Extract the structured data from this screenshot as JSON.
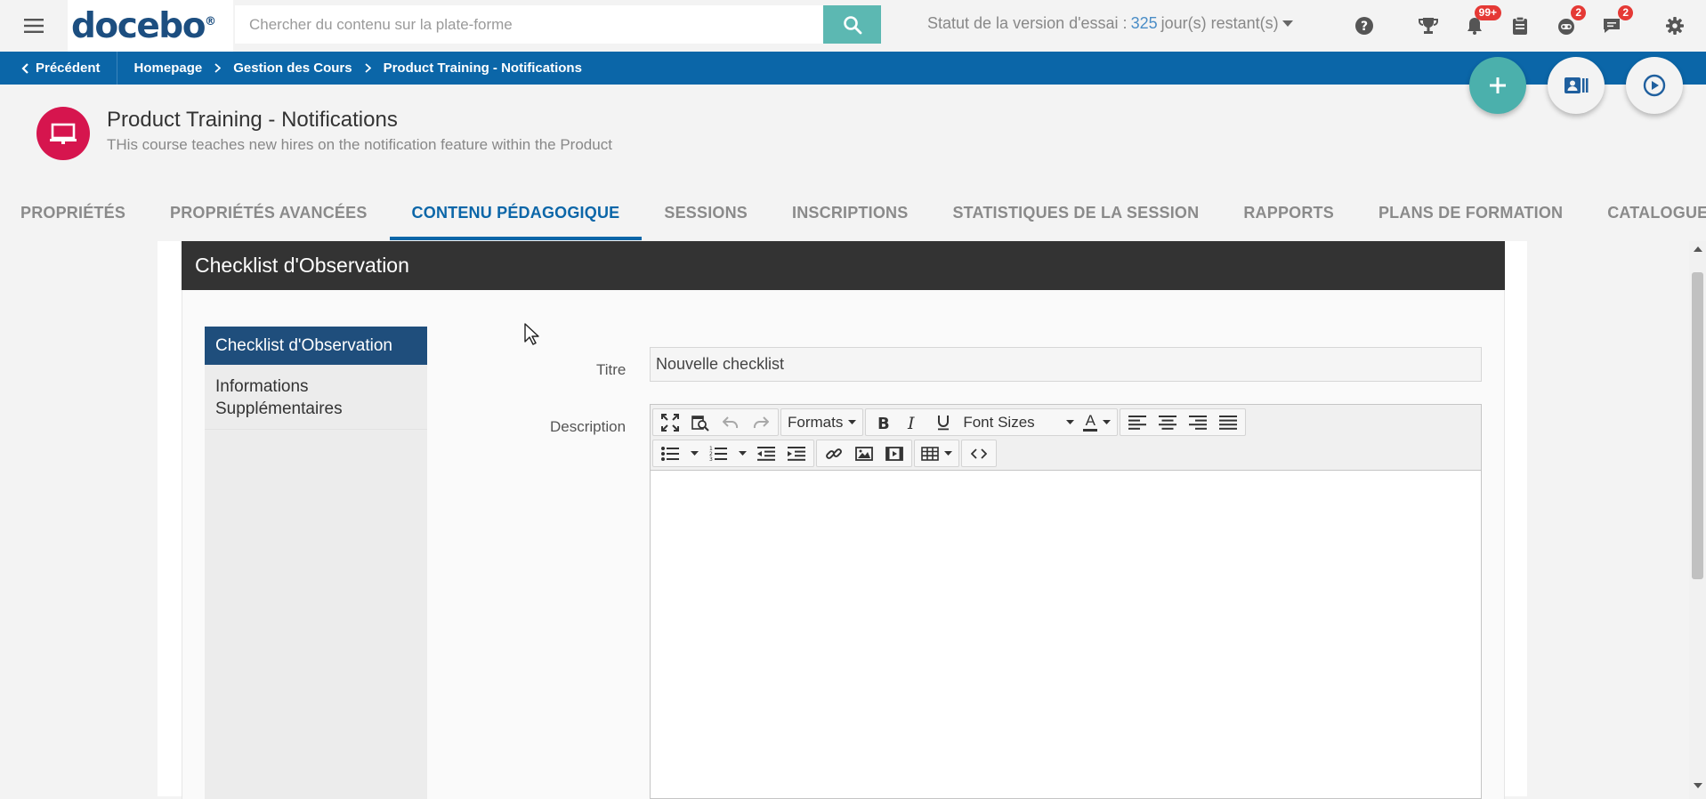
{
  "topbar": {
    "logo": "docebo",
    "logo_mark": "®",
    "search_placeholder": "Chercher du contenu sur la plate-forme",
    "trial_prefix": "Statut de la version d'essai :",
    "trial_days": "325",
    "trial_suffix": "jour(s) restant(s)",
    "badges": {
      "notifications": "99+",
      "messages_a": "2",
      "messages_b": "2"
    },
    "icons": [
      "menu-icon",
      "search-icon",
      "help-icon",
      "trophy-icon",
      "bell-icon",
      "clipboard-icon",
      "bot-chat-icon",
      "chat-icon",
      "gear-icon"
    ]
  },
  "breadcrumb": {
    "back": "Précédent",
    "items": [
      "Homepage",
      "Gestion des Cours",
      "Product Training - Notifications"
    ]
  },
  "course": {
    "title": "Product Training - Notifications",
    "description": "THis course teaches new hires on the notification feature within the Product"
  },
  "tabs": [
    "PROPRIÉTÉS",
    "PROPRIÉTÉS AVANCÉES",
    "CONTENU PÉDAGOGIQUE",
    "SESSIONS",
    "INSCRIPTIONS",
    "STATISTIQUES DE LA SESSION",
    "RAPPORTS",
    "PLANS DE FORMATION",
    "CATALOGUES"
  ],
  "active_tab": "CONTENU PÉDAGOGIQUE",
  "panel": {
    "title": "Checklist d'Observation",
    "side_items": [
      "Checklist d'Observation",
      "Informations Supplémentaires"
    ],
    "title_label": "Titre",
    "title_value": "Nouvelle checklist",
    "description_label": "Description",
    "toolbar": {
      "formats": "Formats",
      "font_sizes": "Font Sizes",
      "text_color_glyph": "A"
    }
  },
  "colors": {
    "brand_blue": "#0b66a8",
    "teal": "#4bb0ac",
    "course_red": "#d6154e",
    "panel_dark": "#333333",
    "side_active": "#1f4e7c",
    "badge_red": "#e53935"
  }
}
